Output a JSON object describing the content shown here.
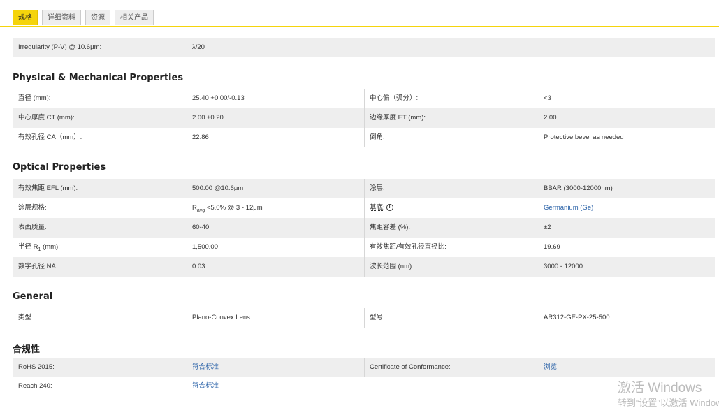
{
  "tabs": [
    "规格",
    "详细资料",
    "资源",
    "相关产品"
  ],
  "top": {
    "label": "Irregularity (P-V) @ 10.6μm:",
    "value": "λ/20"
  },
  "physical": {
    "title": "Physical & Mechanical Properties",
    "rows": [
      [
        "直径 (mm):",
        "25.40 +0.00/-0.13",
        "中心偏（弧分）:",
        "<3"
      ],
      [
        "中心厚度 CT (mm):",
        "2.00 ±0.20",
        "边缘厚度 ET (mm):",
        "2.00"
      ],
      [
        "有效孔径 CA（mm）:",
        "22.86",
        "倒角:",
        "Protective bevel as needed"
      ]
    ]
  },
  "optical": {
    "title": "Optical Properties",
    "r1": [
      "有效焦距 EFL (mm):",
      "500.00 @10.6μm",
      "涂层:",
      "BBAR (3000-12000nm)"
    ],
    "r2": {
      "label": "涂层规格:",
      "value_prefix": "R",
      "value_sub": "avg",
      "value_rest": " <5.0% @ 3 - 12μm",
      "label2": "基底:",
      "info": "i",
      "value2": "Germanium (Ge)"
    },
    "r3": [
      "表面质量:",
      "60-40",
      "焦距容差 (%):",
      "±2"
    ],
    "r4": {
      "label_prefix": "半径 R",
      "label_sub": "1",
      "label_rest": " (mm):",
      "value": "1,500.00",
      "label2": "有效焦距/有效孔径直径比:",
      "value2": "19.69"
    },
    "r5": [
      "数字孔径 NA:",
      "0.03",
      "波长范围 (nm):",
      "3000 - 12000"
    ]
  },
  "general": {
    "title": "General",
    "rows": [
      [
        "类型:",
        "Plano-Convex Lens",
        "型号:",
        "AR312-GE-PX-25-500"
      ]
    ]
  },
  "compliance": {
    "title": "合规性",
    "r1": [
      "RoHS 2015:",
      "符合标准",
      "Certificate of Conformance:",
      "浏览"
    ],
    "r2": [
      "Reach 240:",
      "符合标准"
    ]
  },
  "watermark": {
    "line1": "激活 Windows",
    "line2": "转到“设置”以激活 Windows。"
  }
}
